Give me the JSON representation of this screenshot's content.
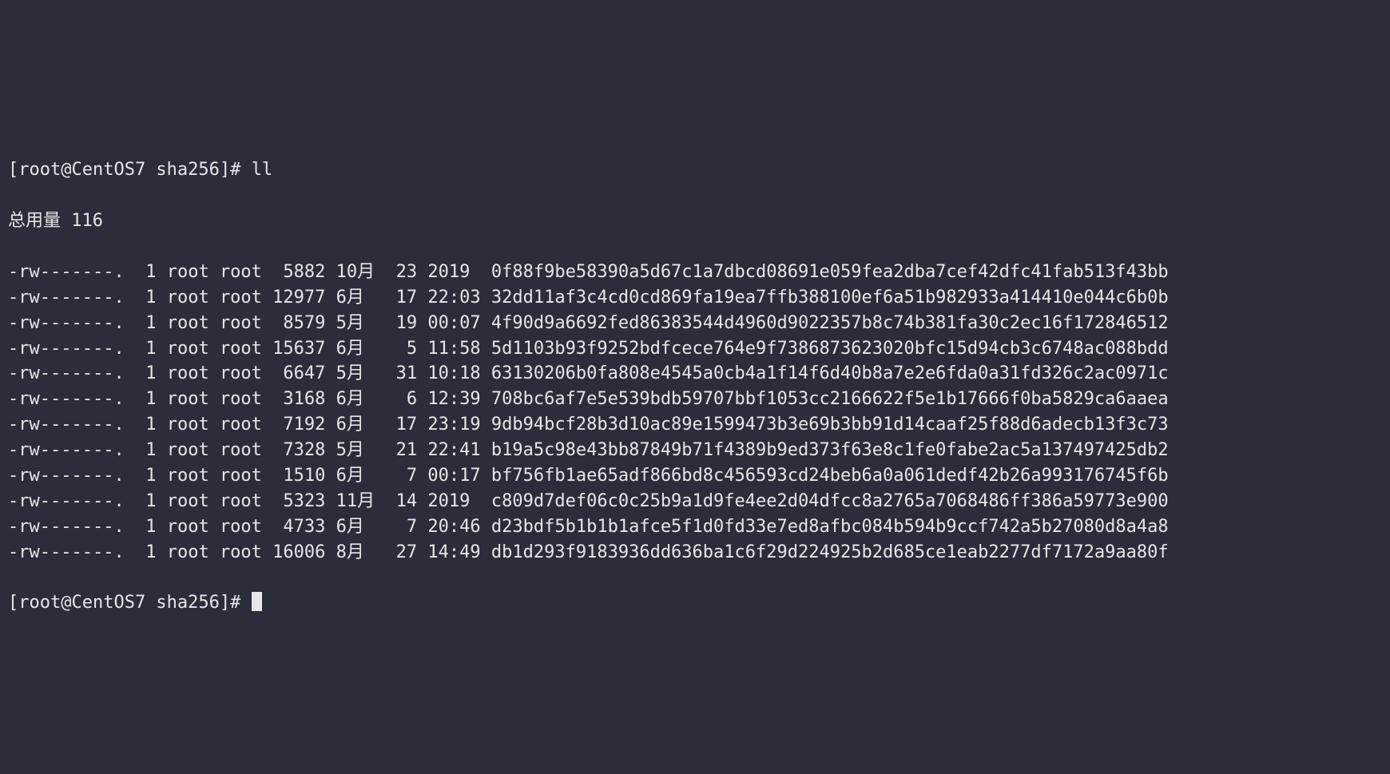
{
  "prompt": {
    "user": "root",
    "host": "CentOS7",
    "cwd_name": "sha256",
    "symbol": "#",
    "text": "[root@CentOS7 sha256]#"
  },
  "command1": "ll",
  "total_line": "总用量 116",
  "listing": [
    {
      "perms": "-rw-------.",
      "links": "1",
      "owner": "root",
      "group": "root",
      "size": "5882",
      "month": "10月",
      "day": "23",
      "time": "2019",
      "name": "0f88f9be58390a5d67c1a7dbcd08691e059fea2dba7cef42dfc41fab513f43bb"
    },
    {
      "perms": "-rw-------.",
      "links": "1",
      "owner": "root",
      "group": "root",
      "size": "12977",
      "month": "6月",
      "day": "17",
      "time": "22:03",
      "name": "32dd11af3c4cd0cd869fa19ea7ffb388100ef6a51b982933a414410e044c6b0b"
    },
    {
      "perms": "-rw-------.",
      "links": "1",
      "owner": "root",
      "group": "root",
      "size": "8579",
      "month": "5月",
      "day": "19",
      "time": "00:07",
      "name": "4f90d9a6692fed86383544d4960d9022357b8c74b381fa30c2ec16f172846512"
    },
    {
      "perms": "-rw-------.",
      "links": "1",
      "owner": "root",
      "group": "root",
      "size": "15637",
      "month": "6月",
      "day": "5",
      "time": "11:58",
      "name": "5d1103b93f9252bdfcece764e9f7386873623020bfc15d94cb3c6748ac088bdd"
    },
    {
      "perms": "-rw-------.",
      "links": "1",
      "owner": "root",
      "group": "root",
      "size": "6647",
      "month": "5月",
      "day": "31",
      "time": "10:18",
      "name": "63130206b0fa808e4545a0cb4a1f14f6d40b8a7e2e6fda0a31fd326c2ac0971c"
    },
    {
      "perms": "-rw-------.",
      "links": "1",
      "owner": "root",
      "group": "root",
      "size": "3168",
      "month": "6月",
      "day": "6",
      "time": "12:39",
      "name": "708bc6af7e5e539bdb59707bbf1053cc2166622f5e1b17666f0ba5829ca6aaea"
    },
    {
      "perms": "-rw-------.",
      "links": "1",
      "owner": "root",
      "group": "root",
      "size": "7192",
      "month": "6月",
      "day": "17",
      "time": "23:19",
      "name": "9db94bcf28b3d10ac89e1599473b3e69b3bb91d14caaf25f88d6adecb13f3c73"
    },
    {
      "perms": "-rw-------.",
      "links": "1",
      "owner": "root",
      "group": "root",
      "size": "7328",
      "month": "5月",
      "day": "21",
      "time": "22:41",
      "name": "b19a5c98e43bb87849b71f4389b9ed373f63e8c1fe0fabe2ac5a137497425db2"
    },
    {
      "perms": "-rw-------.",
      "links": "1",
      "owner": "root",
      "group": "root",
      "size": "1510",
      "month": "6月",
      "day": "7",
      "time": "00:17",
      "name": "bf756fb1ae65adf866bd8c456593cd24beb6a0a061dedf42b26a993176745f6b"
    },
    {
      "perms": "-rw-------.",
      "links": "1",
      "owner": "root",
      "group": "root",
      "size": "5323",
      "month": "11月",
      "day": "14",
      "time": "2019",
      "name": "c809d7def06c0c25b9a1d9fe4ee2d04dfcc8a2765a7068486ff386a59773e900"
    },
    {
      "perms": "-rw-------.",
      "links": "1",
      "owner": "root",
      "group": "root",
      "size": "4733",
      "month": "6月",
      "day": "7",
      "time": "20:46",
      "name": "d23bdf5b1b1b1afce5f1d0fd33e7ed8afbc084b594b9ccf742a5b27080d8a4a8"
    },
    {
      "perms": "-rw-------.",
      "links": "1",
      "owner": "root",
      "group": "root",
      "size": "16006",
      "month": "8月",
      "day": "27",
      "time": "14:49",
      "name": "db1d293f9183936dd636ba1c6f29d224925b2d685ce1eab2277df7172a9aa80f"
    }
  ]
}
